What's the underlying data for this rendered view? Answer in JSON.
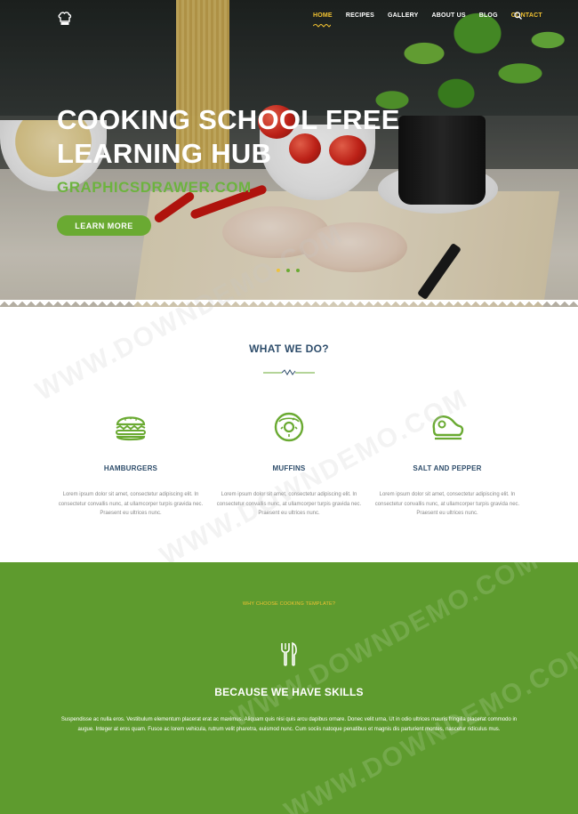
{
  "nav": {
    "items": [
      {
        "label": "HOME",
        "active": true
      },
      {
        "label": "RECIPES",
        "active": false
      },
      {
        "label": "GALLERY",
        "active": false
      },
      {
        "label": "ABOUT US",
        "active": false
      },
      {
        "label": "BLOG",
        "active": false
      },
      {
        "label": "CONTACT",
        "active": false
      }
    ],
    "logo_icon": "chef-hat-icon",
    "search_icon": "search-icon"
  },
  "hero": {
    "title": "COOKING SCHOOL FREE LEARNING HUB",
    "subtitle": "GRAPHICSDRAWER.COM",
    "button_label": "LEARN MORE",
    "slides_count": 3,
    "active_slide": 1
  },
  "what_we_do": {
    "title": "WHAT WE DO?",
    "features": [
      {
        "icon": "hamburger-icon",
        "name": "HAMBURGERS",
        "text": "Lorem ipsum dolor sit amet, consectetur adipiscing elit. In consectetur convallis nunc, at ullamcorper turpis gravida nec. Praesent eu ultrices nunc."
      },
      {
        "icon": "donut-icon",
        "name": "MUFFINS",
        "text": "Lorem ipsum dolor sit amet, consectetur adipiscing elit. In consectetur convallis nunc, at ullamcorper turpis gravida nec. Praesent eu ultrices nunc."
      },
      {
        "icon": "steak-icon",
        "name": "SALT AND PEPPER",
        "text": "Lorem ipsum dolor sit amet, consectetur adipiscing elit. In consectetur convallis nunc, at ullamcorper turpis gravida nec. Praesent eu ultrices nunc."
      }
    ]
  },
  "skills": {
    "eyebrow": "WHY CHOOSE COOKING TEMPLATE?",
    "icon": "fork-knife-icon",
    "title": "BECAUSE WE HAVE SKILLS",
    "text": "Suspendisse ac nulla eros. Vestibulum elementum placerat erat ac maximus. Aliquam quis nisi quis arcu dapibus ornare. Donec velit urna, Ut in odio ultrices mauris fringilla placerat commodo in augue. Integer at eros quam. Fusce ac lorem vehicula, rutrum velit pharetra, euismod nunc. Cum sociis natoque penatibus et magnis dis parturient montes, nascetur ridiculus mus."
  },
  "watermark": "WWW.DOWNDEMO.COM",
  "colors": {
    "accent_green": "#5e9b2e",
    "button_green": "#6aaa32",
    "nav_active_yellow": "#f1c232",
    "heading_blue": "#2e4d6b"
  }
}
